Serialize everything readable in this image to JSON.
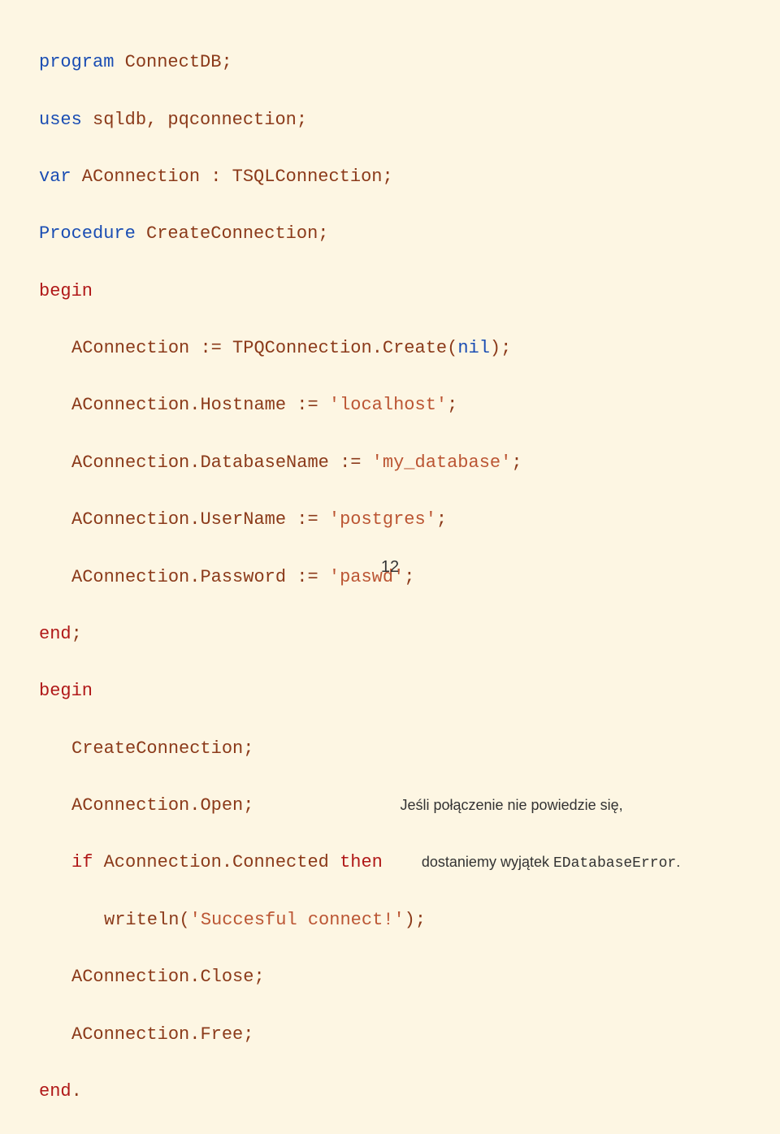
{
  "code": {
    "l1_kw1": "program",
    "l1_name": " ConnectDB",
    "l1_punct": ";",
    "l2_kw1": "uses",
    "l2_units": " sqldb",
    "l2_comma": ",",
    "l2_units2": " pqconnection",
    "l2_punct": ";",
    "l3_kw1": "var",
    "l3_decl1": " AConnection ",
    "l3_colon": ":",
    "l3_decl2": " TSQLConnection",
    "l3_punct": ";",
    "l4_kw1": "Procedure",
    "l4_name": " CreateConnection",
    "l4_punct": ";",
    "l5_kw": "begin",
    "l6_lhs": "AConnection ",
    "l6_assign": ":=",
    "l6_rhs": " TPQConnection",
    "l6_dot": ".",
    "l6_method": "Create",
    "l6_paren": "(",
    "l6_nil": "nil",
    "l6_paren2": ");",
    "l7_lhs": "AConnection",
    "l7_dot": ".",
    "l7_prop": "Hostname ",
    "l7_assign": ":=",
    "l7_q1": " '",
    "l7_str": "localhost",
    "l7_q2": "'",
    "l7_punct": ";",
    "l8_lhs": "AConnection",
    "l8_dot": ".",
    "l8_prop": "DatabaseName ",
    "l8_assign": ":=",
    "l8_q1": " '",
    "l8_str": "my_database",
    "l8_q2": "'",
    "l8_punct": ";",
    "l9_lhs": "AConnection",
    "l9_dot": ".",
    "l9_prop": "UserName ",
    "l9_assign": ":=",
    "l9_q1": " '",
    "l9_str": "postgres",
    "l9_q2": "'",
    "l9_punct": ";",
    "l10_lhs": "AConnection",
    "l10_dot": ".",
    "l10_prop": "Password ",
    "l10_assign": ":=",
    "l10_q1": " '",
    "l10_str": "paswd",
    "l10_q2": "'",
    "l10_punct": ";",
    "l11_kw": "end",
    "l11_punct": ";",
    "l12_kw": "begin",
    "l13_call": "CreateConnection",
    "l13_punct": ";",
    "l14_obj": "AConnection",
    "l14_dot": ".",
    "l14_method": "Open",
    "l14_punct": ";",
    "l15_kw": "if",
    "l15_obj": " Aconnection",
    "l15_dot": ".",
    "l15_prop": "Connected ",
    "l15_then": "then",
    "l16_fn": "writeln",
    "l16_paren": "(",
    "l16_q1": "'",
    "l16_str": "Succesful connect!",
    "l16_q2": "'",
    "l16_paren2": ");",
    "l17_obj": "AConnection",
    "l17_dot": ".",
    "l17_method": "Close",
    "l17_punct": ";",
    "l18_obj": "AConnection",
    "l18_dot": ".",
    "l18_method": "Free",
    "l18_punct": ";",
    "l19_kw": "end",
    "l19_punct": "."
  },
  "comments": {
    "line14": "Jeśli połączenie nie powiedzie się,",
    "line15a": "dostaniemy wyjątek ",
    "line15b": "EDatabaseError",
    "line15c": "."
  },
  "page_number": "12"
}
